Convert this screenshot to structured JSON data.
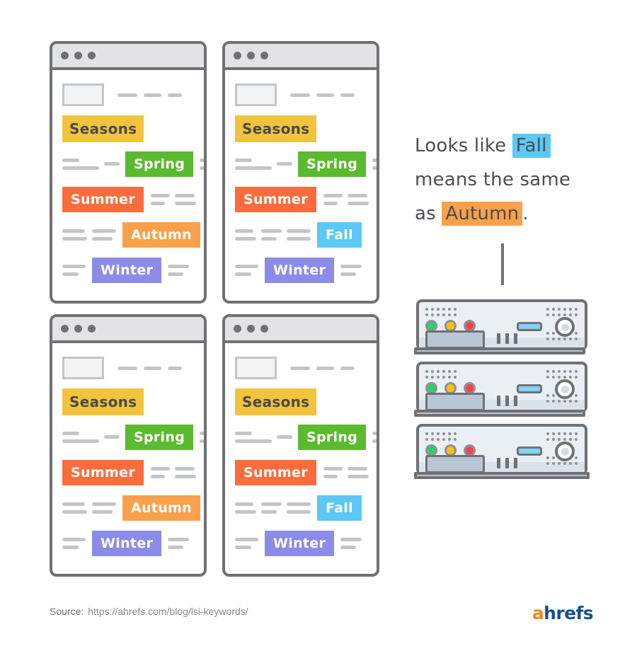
{
  "colors": {
    "seasons": "#f2c43d",
    "spring": "#5bba2f",
    "summer": "#fa6c3c",
    "autumn": "#f9a14a",
    "fall": "#5bc8f5",
    "winter": "#8b8ce8",
    "outline": "#6f7175",
    "dash": "#c4c5c7",
    "text_dark": "#4c4c52",
    "logo_orange": "#f08a1e",
    "logo_blue": "#14518f"
  },
  "windows": [
    {
      "id": "top-left",
      "variant": "autumn",
      "tags": [
        {
          "label": "Seasons",
          "color": "#f2c43d"
        },
        {
          "label": "Spring",
          "color": "#5bba2f"
        },
        {
          "label": "Summer",
          "color": "#fa6c3c"
        },
        {
          "label": "Autumn",
          "color": "#f9a14a"
        },
        {
          "label": "Winter",
          "color": "#8b8ce8"
        }
      ]
    },
    {
      "id": "top-right",
      "variant": "fall",
      "tags": [
        {
          "label": "Seasons",
          "color": "#f2c43d"
        },
        {
          "label": "Spring",
          "color": "#5bba2f"
        },
        {
          "label": "Summer",
          "color": "#fa6c3c"
        },
        {
          "label": "Fall",
          "color": "#5bc8f5"
        },
        {
          "label": "Winter",
          "color": "#8b8ce8"
        }
      ]
    },
    {
      "id": "bottom-left",
      "variant": "autumn",
      "tags": [
        {
          "label": "Seasons",
          "color": "#f2c43d"
        },
        {
          "label": "Spring",
          "color": "#5bba2f"
        },
        {
          "label": "Summer",
          "color": "#fa6c3c"
        },
        {
          "label": "Autumn",
          "color": "#f9a14a"
        },
        {
          "label": "Winter",
          "color": "#8b8ce8"
        }
      ]
    },
    {
      "id": "bottom-right",
      "variant": "fall",
      "tags": [
        {
          "label": "Seasons",
          "color": "#f2c43d"
        },
        {
          "label": "Spring",
          "color": "#5bba2f"
        },
        {
          "label": "Summer",
          "color": "#fa6c3c"
        },
        {
          "label": "Fall",
          "color": "#5bc8f5"
        },
        {
          "label": "Winter",
          "color": "#8b8ce8"
        }
      ]
    }
  ],
  "callout": {
    "line1_pre": "Looks like ",
    "line1_hl": "Fall",
    "line1_hl_color": "#5bc8f5",
    "line2": "means the same",
    "line3_pre": "as ",
    "line3_hl": "Autumn",
    "line3_hl_color": "#f9a14a",
    "line3_post": "."
  },
  "servers": {
    "count": 3,
    "leds": [
      "green",
      "amber",
      "red"
    ],
    "led_colors": {
      "green": "#2ed06a",
      "amber": "#fcc10a",
      "red": "#f9414a"
    }
  },
  "footer": {
    "source_label": "Source:",
    "source_url": "https://ahrefs.com/blog/lsi-keywords/",
    "logo_a": "a",
    "logo_rest": "hrefs"
  }
}
